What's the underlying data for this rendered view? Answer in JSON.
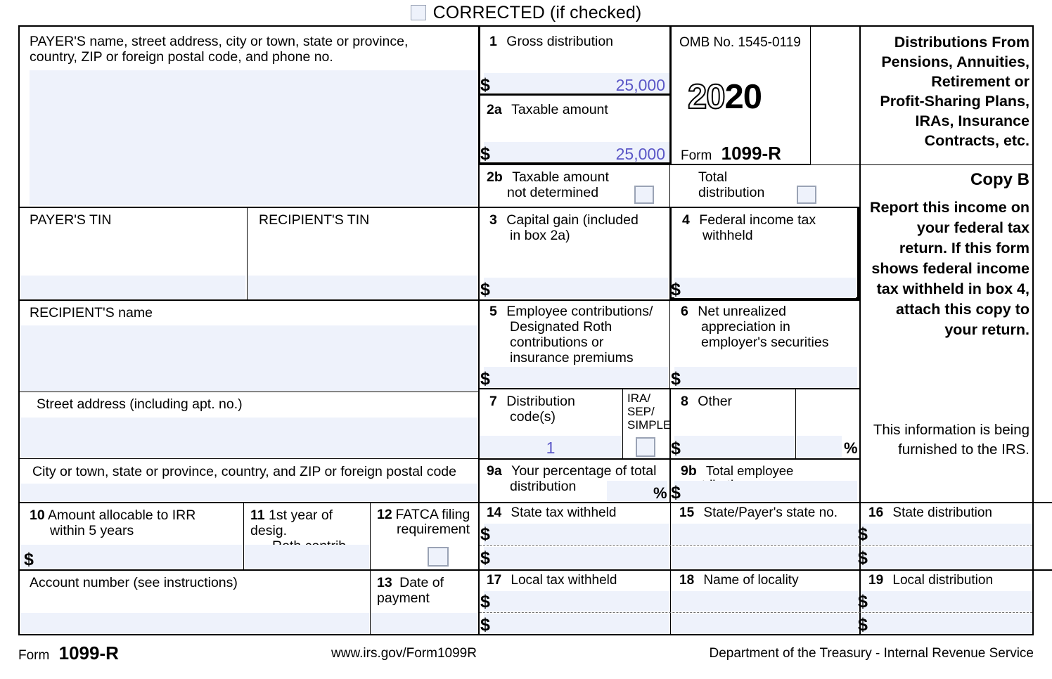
{
  "header": {
    "corrected_label": "CORRECTED (if checked)",
    "corrected_checked": false
  },
  "payer": {
    "label_line1": "PAYER'S name, street address, city or town, state or province,",
    "label_line2": "country, ZIP or foreign postal code, and phone no.",
    "value": ""
  },
  "payer_tin": {
    "label": "PAYER'S TIN",
    "value": ""
  },
  "recipient_tin": {
    "label": "RECIPIENT'S TIN",
    "value": ""
  },
  "recipient_name": {
    "label": "RECIPIENT'S name",
    "value": ""
  },
  "street_address": {
    "label": "Street address (including apt. no.)",
    "value": ""
  },
  "city_state_zip": {
    "label": "City or town, state or province, country, and ZIP or foreign postal code",
    "value": ""
  },
  "account_number": {
    "label": "Account number (see instructions)",
    "value": ""
  },
  "omb": {
    "label": "OMB No. 1545-0119"
  },
  "year": {
    "prefix": "20",
    "suffix": "20"
  },
  "form_header": {
    "word": "Form",
    "number": "1099-R"
  },
  "legend": {
    "title_lines": [
      "Distributions From",
      "Pensions, Annuities,",
      "Retirement or",
      "Profit-Sharing Plans,",
      "IRAs, Insurance",
      "Contracts, etc."
    ],
    "copy_label": "Copy  B",
    "copy_body": "Report this income on your federal tax return. If this form shows federal income tax withheld in box 4, attach this copy to your return.",
    "copy_note": "This information is being furnished to the IRS."
  },
  "boxes": {
    "b1": {
      "num": "1",
      "label": "Gross distribution",
      "currency": "$",
      "value": "25,000"
    },
    "b2a": {
      "num": "2a",
      "label": "Taxable amount",
      "currency": "$",
      "value": "25,000"
    },
    "b2b": {
      "num": "2b",
      "label_line1": "Taxable amount",
      "label_line2": "not determined",
      "checked": false
    },
    "total_distribution": {
      "label_line1": "Total",
      "label_line2": "distribution",
      "checked": false
    },
    "b3": {
      "num": "3",
      "label_line1": "Capital gain (included",
      "label_line2": "in box 2a)",
      "currency": "$",
      "value": ""
    },
    "b4": {
      "num": "4",
      "label_line1": "Federal income tax",
      "label_line2": "withheld",
      "currency": "$",
      "value": ""
    },
    "b5": {
      "num": "5",
      "label_line1": "Employee contributions/",
      "label_line2": "Designated Roth",
      "label_line3": "contributions or",
      "label_line4": "insurance premiums",
      "currency": "$",
      "value": ""
    },
    "b6": {
      "num": "6",
      "label_line1": "Net unrealized",
      "label_line2": "appreciation in",
      "label_line3": "employer's securities",
      "currency": "$",
      "value": ""
    },
    "b7": {
      "num": "7",
      "label_line1": "Distribution",
      "label_line2": "code(s)",
      "value": "1"
    },
    "ira_sep_simple": {
      "label_line1": "IRA/",
      "label_line2": "SEP/",
      "label_line3": "SIMPLE",
      "checked": false
    },
    "b8": {
      "num": "8",
      "label": "Other",
      "currency": "$",
      "value": "",
      "percent_sign": "%",
      "percent_value": ""
    },
    "b9a": {
      "num": "9a",
      "label_line1": "Your percentage of total",
      "label_line2": "distribution",
      "percent_sign": "%",
      "value": ""
    },
    "b9b": {
      "num": "9b",
      "label": "Total employee contributions",
      "currency": "$",
      "value": ""
    },
    "b10": {
      "num": "10",
      "label_line1": "Amount allocable to IRR",
      "label_line2": "within 5 years",
      "currency": "$",
      "value": ""
    },
    "b11": {
      "num": "11",
      "label_line1": "1st year of desig.",
      "label_line2": "Roth contrib.",
      "value": ""
    },
    "b12": {
      "num": "12",
      "label_line1": "FATCA filing",
      "label_line2": "requirement",
      "checked": false
    },
    "b13": {
      "num": "13",
      "label_line1": "Date of",
      "label_line2": "payment",
      "value": ""
    },
    "b14": {
      "num": "14",
      "label": "State tax withheld",
      "currency": "$",
      "value_row1": "",
      "value_row2": ""
    },
    "b15": {
      "num": "15",
      "label": "State/Payer's state no.",
      "value_row1": "",
      "value_row2": ""
    },
    "b16": {
      "num": "16",
      "label": "State distribution",
      "currency": "$",
      "value_row1": "",
      "value_row2": ""
    },
    "b17": {
      "num": "17",
      "label": "Local tax withheld",
      "currency": "$",
      "value_row1": "",
      "value_row2": ""
    },
    "b18": {
      "num": "18",
      "label": "Name of locality",
      "value_row1": "",
      "value_row2": ""
    },
    "b19": {
      "num": "19",
      "label": "Local distribution",
      "currency": "$",
      "value_row1": "",
      "value_row2": ""
    }
  },
  "footer": {
    "form_word": "Form",
    "form_number": "1099-R",
    "url": "www.irs.gov/Form1099R",
    "agency": "Department of the Treasury - Internal Revenue Service"
  },
  "colors": {
    "field_fill": "#eef2fb",
    "value_text": "#5b57c7",
    "rule": "#000000"
  }
}
